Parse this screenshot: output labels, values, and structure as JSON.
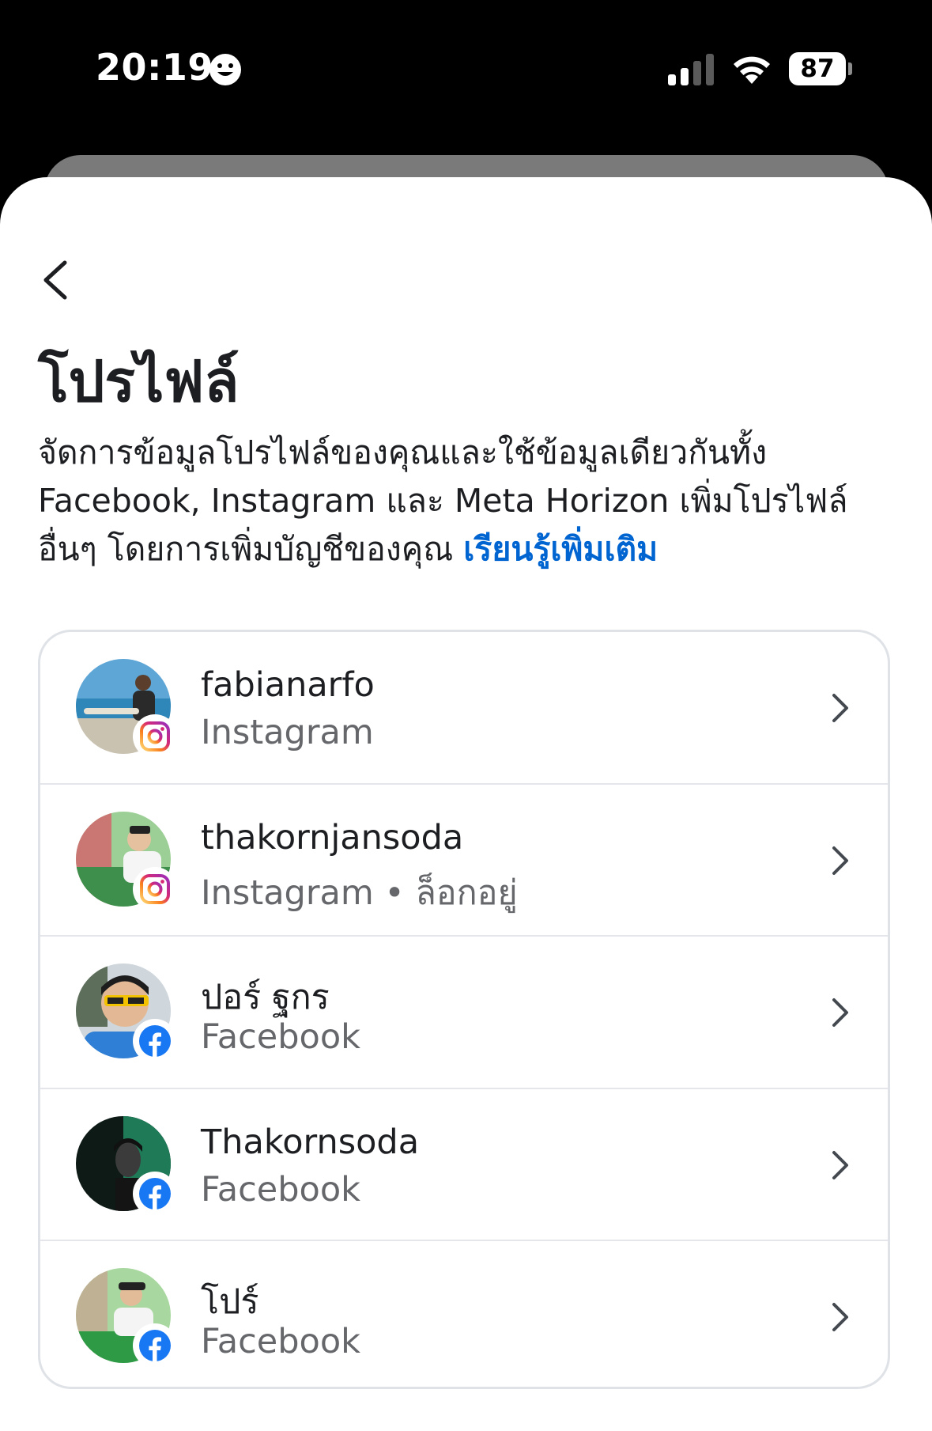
{
  "status_bar": {
    "time": "20:19",
    "battery": "87"
  },
  "header": {
    "title": "โปรไฟล์",
    "description": "จัดการข้อมูลโปรไฟล์ของคุณและใช้ข้อมูลเดียวกันทั้ง Facebook, Instagram และ Meta Horizon เพิ่มโปรไฟล์อื่นๆ โดยการเพิ่มบัญชีของคุณ",
    "learn_more": "เรียนรู้เพิ่มเติม"
  },
  "profiles": [
    {
      "name": "fabianarfo",
      "platform": "Instagram",
      "badge": "instagram-icon",
      "avatar_color": "#7fb6d8"
    },
    {
      "name": "thakornjansoda",
      "platform": "Instagram • ล็อกอยู่",
      "badge": "instagram-icon",
      "avatar_color": "#8cc08a"
    },
    {
      "name": "ปอร์ ฐกร",
      "platform": "Facebook",
      "badge": "facebook-icon",
      "avatar_color": "#3f7fd0"
    },
    {
      "name": "Thakornsoda",
      "platform": "Facebook",
      "badge": "facebook-icon",
      "avatar_color": "#0f1f1a"
    },
    {
      "name": "โปร์",
      "platform": "Facebook",
      "badge": "facebook-icon",
      "avatar_color": "#6fbf76"
    }
  ],
  "colors": {
    "link": "#0064d1",
    "secondary_text": "#65676b",
    "facebook_blue": "#1877f2"
  }
}
